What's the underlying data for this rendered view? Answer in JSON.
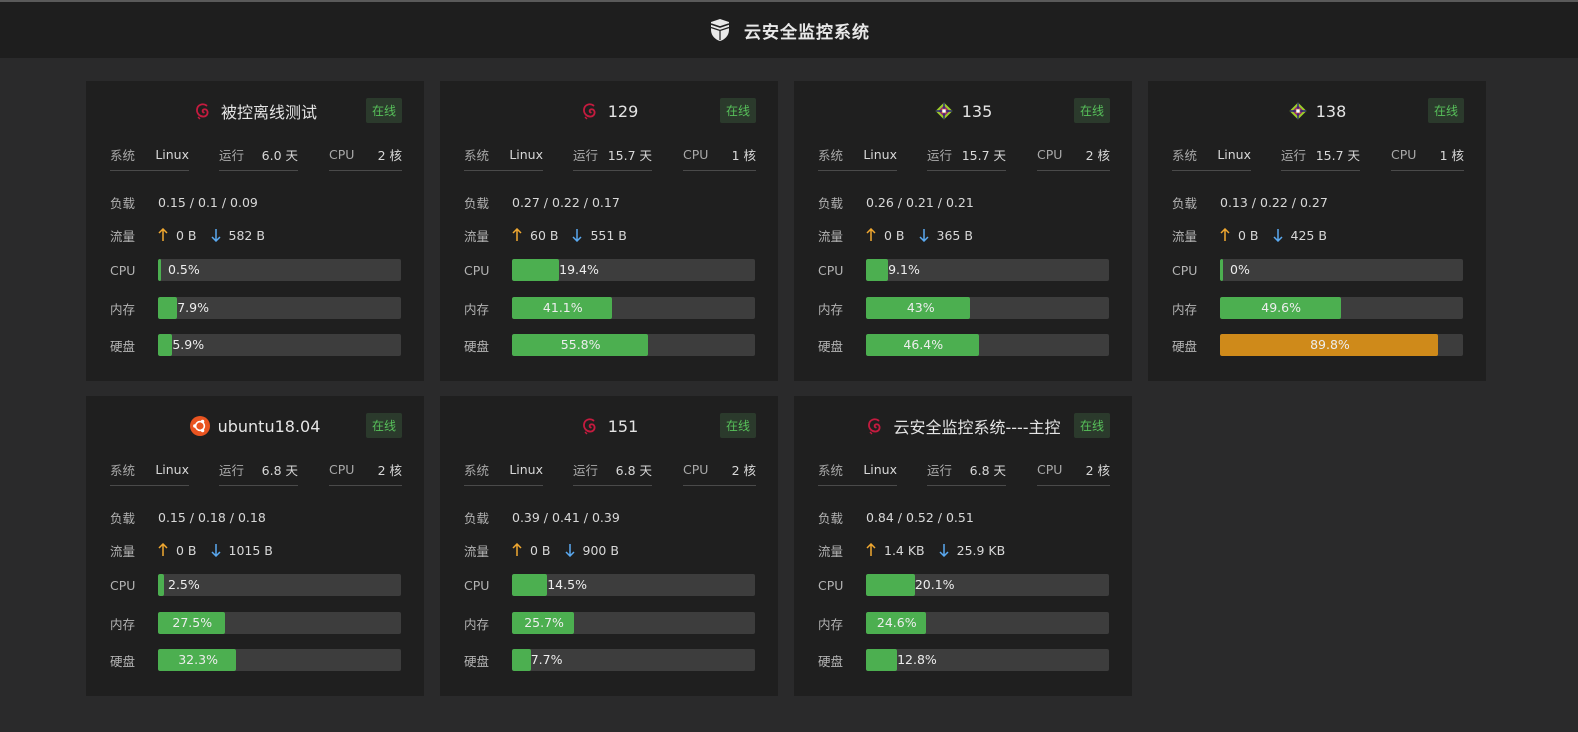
{
  "header": {
    "title": "云安全监控系统",
    "logo_icon": "shield-logo-icon"
  },
  "labels": {
    "system": "系统",
    "uptime": "运行",
    "cpu": "CPU",
    "load": "负载",
    "traffic": "流量",
    "cpu_bar": "CPU",
    "mem": "内存",
    "disk": "硬盘"
  },
  "colors": {
    "ok": "#4caf50",
    "warn": "#cf8a1a",
    "online": "#57c05a",
    "up_arrow": "#f0a830",
    "down_arrow": "#5aa9f0"
  },
  "servers": [
    {
      "name": "被控离线测试",
      "os_icon": "debian-icon",
      "status": "在线",
      "system": "Linux",
      "uptime": "6.0 天",
      "cores": "2 核",
      "load": "0.15 / 0.1 / 0.09",
      "net_up": "0 B",
      "net_down": "582 B",
      "cpu": 0.5,
      "cpu_text": "0.5%",
      "mem": 7.9,
      "mem_text": "7.9%",
      "disk": 5.9,
      "disk_text": "5.9%"
    },
    {
      "name": "129",
      "os_icon": "debian-icon",
      "status": "在线",
      "system": "Linux",
      "uptime": "15.7 天",
      "cores": "1 核",
      "load": "0.27 / 0.22 / 0.17",
      "net_up": "60 B",
      "net_down": "551 B",
      "cpu": 19.4,
      "cpu_text": "19.4%",
      "mem": 41.1,
      "mem_text": "41.1%",
      "disk": 55.8,
      "disk_text": "55.8%"
    },
    {
      "name": "135",
      "os_icon": "centos-icon",
      "status": "在线",
      "system": "Linux",
      "uptime": "15.7 天",
      "cores": "2 核",
      "load": "0.26 / 0.21 / 0.21",
      "net_up": "0 B",
      "net_down": "365 B",
      "cpu": 9.1,
      "cpu_text": "9.1%",
      "mem": 43,
      "mem_text": "43%",
      "disk": 46.4,
      "disk_text": "46.4%"
    },
    {
      "name": "138",
      "os_icon": "centos-icon",
      "status": "在线",
      "system": "Linux",
      "uptime": "15.7 天",
      "cores": "1 核",
      "load": "0.13 / 0.22 / 0.27",
      "net_up": "0 B",
      "net_down": "425 B",
      "cpu": 0,
      "cpu_text": "0%",
      "mem": 49.6,
      "mem_text": "49.6%",
      "disk": 89.8,
      "disk_text": "89.8%"
    },
    {
      "name": "ubuntu18.04",
      "os_icon": "ubuntu-icon",
      "status": "在线",
      "system": "Linux",
      "uptime": "6.8 天",
      "cores": "2 核",
      "load": "0.15 / 0.18 / 0.18",
      "net_up": "0 B",
      "net_down": "1015 B",
      "cpu": 2.5,
      "cpu_text": "2.5%",
      "mem": 27.5,
      "mem_text": "27.5%",
      "disk": 32.3,
      "disk_text": "32.3%"
    },
    {
      "name": "151",
      "os_icon": "debian-icon",
      "status": "在线",
      "system": "Linux",
      "uptime": "6.8 天",
      "cores": "2 核",
      "load": "0.39 / 0.41 / 0.39",
      "net_up": "0 B",
      "net_down": "900 B",
      "cpu": 14.5,
      "cpu_text": "14.5%",
      "mem": 25.7,
      "mem_text": "25.7%",
      "disk": 7.7,
      "disk_text": "7.7%"
    },
    {
      "name": "云安全监控系统----主控",
      "os_icon": "debian-icon",
      "status": "在线",
      "system": "Linux",
      "uptime": "6.8 天",
      "cores": "2 核",
      "load": "0.84 / 0.52 / 0.51",
      "net_up": "1.4 KB",
      "net_down": "25.9 KB",
      "cpu": 20.1,
      "cpu_text": "20.1%",
      "mem": 24.6,
      "mem_text": "24.6%",
      "disk": 12.8,
      "disk_text": "12.8%"
    }
  ]
}
